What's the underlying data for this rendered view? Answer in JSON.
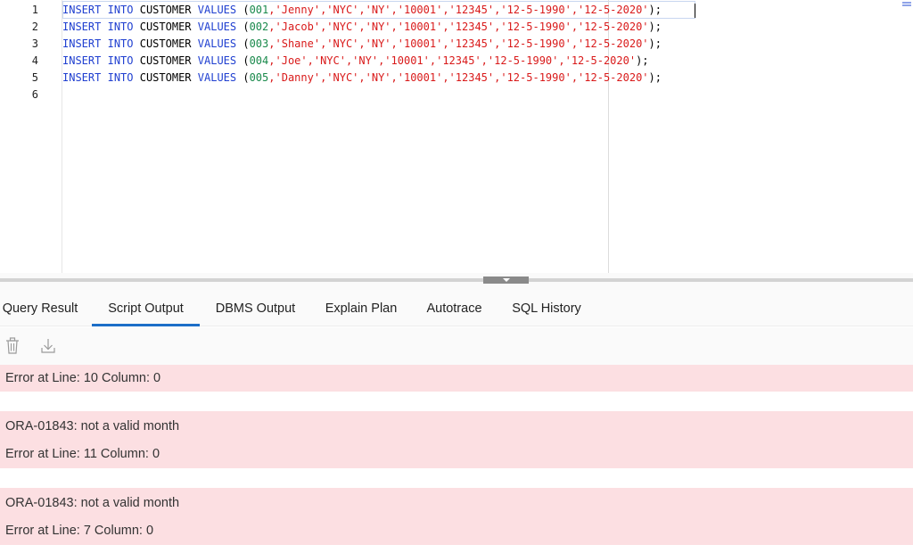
{
  "editor": {
    "line_numbers": [
      "1",
      "2",
      "3",
      "4",
      "5",
      "6"
    ],
    "lines": [
      {
        "kw1": "INSERT",
        "kw2": "INTO",
        "table": "CUSTOMER",
        "kw3": "VALUES",
        "open": " (",
        "id": "001",
        "values": ",'Jenny','NYC','NY','10001','12345','12-5-1990','12-5-2020'",
        "close": ");"
      },
      {
        "kw1": "INSERT",
        "kw2": "INTO",
        "table": "CUSTOMER",
        "kw3": "VALUES",
        "open": " (",
        "id": "002",
        "values": ",'Jacob','NYC','NY','10001','12345','12-5-1990','12-5-2020'",
        "close": ");"
      },
      {
        "kw1": "INSERT",
        "kw2": "INTO",
        "table": "CUSTOMER",
        "kw3": "VALUES",
        "open": " (",
        "id": "003",
        "values": ",'Shane','NYC','NY','10001','12345','12-5-1990','12-5-2020'",
        "close": ");"
      },
      {
        "kw1": "INSERT",
        "kw2": "INTO",
        "table": "CUSTOMER",
        "kw3": "VALUES",
        "open": " (",
        "id": "004",
        "values": ",'Joe','NYC','NY','10001','12345','12-5-1990','12-5-2020'",
        "close": ");"
      },
      {
        "kw1": "INSERT",
        "kw2": "INTO",
        "table": "CUSTOMER",
        "kw3": "VALUES",
        "open": " (",
        "id": "005",
        "values": ",'Danny','NYC','NY','10001','12345','12-5-1990','12-5-2020'",
        "close": ");"
      }
    ]
  },
  "tabs": [
    {
      "label": "Query Result"
    },
    {
      "label": "Script Output"
    },
    {
      "label": "DBMS Output"
    },
    {
      "label": "Explain Plan"
    },
    {
      "label": "Autotrace"
    },
    {
      "label": "SQL History"
    }
  ],
  "active_tab": "Script Output",
  "toolbar": {
    "clear_icon": "trash-icon",
    "save_icon": "download-icon"
  },
  "output": {
    "messages": [
      {
        "text": "Error at Line: 10 Column: 0"
      },
      {
        "text": "ORA-01843: not a valid month"
      },
      {
        "text": "Error at Line: 11 Column: 0"
      },
      {
        "text": "ORA-01843: not a valid month"
      },
      {
        "text": "Error at Line: 7 Column: 0"
      }
    ]
  },
  "colors": {
    "keyword": "#1f3fd0",
    "number": "#1a8a4c",
    "string": "#d91a1a",
    "error_bg": "#fcdfe2",
    "tab_underline": "#1d6ec8"
  }
}
